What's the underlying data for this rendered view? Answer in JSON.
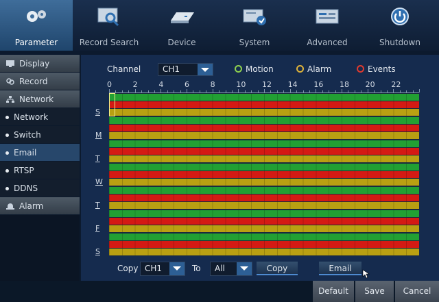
{
  "tabs": [
    {
      "label": "Parameter",
      "icon": "gears-icon",
      "active": true
    },
    {
      "label": "Record Search",
      "icon": "record-search-icon",
      "active": false
    },
    {
      "label": "Device",
      "icon": "device-icon",
      "active": false
    },
    {
      "label": "System",
      "icon": "system-icon",
      "active": false
    },
    {
      "label": "Advanced",
      "icon": "advanced-icon",
      "active": false
    },
    {
      "label": "Shutdown",
      "icon": "shutdown-icon",
      "active": false
    }
  ],
  "sidebar": {
    "items": [
      {
        "label": "Display",
        "type": "group",
        "icon": "display-icon"
      },
      {
        "label": "Record",
        "type": "group",
        "icon": "record-icon"
      },
      {
        "label": "Network",
        "type": "group",
        "icon": "network-icon"
      },
      {
        "label": "Network",
        "type": "child"
      },
      {
        "label": "Switch",
        "type": "child"
      },
      {
        "label": "Email",
        "type": "child",
        "selected": true
      },
      {
        "label": "RTSP",
        "type": "child"
      },
      {
        "label": "DDNS",
        "type": "child"
      },
      {
        "label": "Alarm",
        "type": "group",
        "icon": "alarm-icon"
      }
    ]
  },
  "schedule": {
    "channel_label": "Channel",
    "channel_value": "CH1",
    "legend": [
      {
        "label": "Motion",
        "color": "#8fd14f"
      },
      {
        "label": "Alarm",
        "color": "#e0b43a"
      },
      {
        "label": "Events",
        "color": "#e03a2e"
      }
    ],
    "hour_labels": [
      "0",
      "2",
      "4",
      "6",
      "8",
      "10",
      "12",
      "14",
      "16",
      "18",
      "20",
      "22"
    ],
    "days": [
      "S",
      "M",
      "T",
      "W",
      "T",
      "F",
      "S"
    ],
    "row_colors": [
      "#22a033",
      "#d41a14",
      "#b9a012"
    ],
    "copy_label": "Copy",
    "copy_from": "CH1",
    "to_label": "To",
    "copy_to": "All",
    "copy_button": "Copy",
    "email_button": "Email"
  },
  "footer": {
    "default_label": "Default",
    "save_label": "Save",
    "cancel_label": "Cancel"
  }
}
